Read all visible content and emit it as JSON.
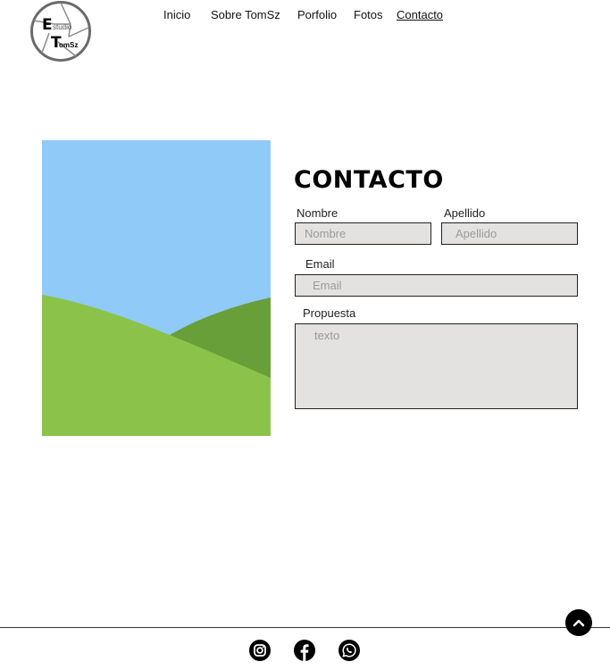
{
  "brand": {
    "logo_letters": [
      "E",
      "studio",
      "T",
      "omSz"
    ]
  },
  "nav": {
    "items": [
      {
        "label": "Inicio"
      },
      {
        "label": "Sobre TomSz"
      },
      {
        "label": "Porfolio"
      },
      {
        "label": "Fotos"
      },
      {
        "label": "Contacto"
      }
    ],
    "active": "Contacto"
  },
  "hero": {
    "image": "landscape-placeholder",
    "colors": {
      "sky": "#90caf9",
      "hill_front": "#8bc34a",
      "hill_back": "#689f38"
    }
  },
  "contact": {
    "title": "CONTACTO",
    "nombre": {
      "label": "Nombre",
      "placeholder": "Nombre"
    },
    "apellido": {
      "label": "Apellido",
      "placeholder": "Apellido"
    },
    "email": {
      "label": "Email",
      "placeholder": "Email"
    },
    "propuesta": {
      "label": "Propuesta",
      "placeholder": "texto"
    }
  },
  "footer": {
    "social": [
      "instagram-icon",
      "facebook-icon",
      "whatsapp-icon"
    ],
    "scroll_top_icon": "chevron-up-icon"
  }
}
